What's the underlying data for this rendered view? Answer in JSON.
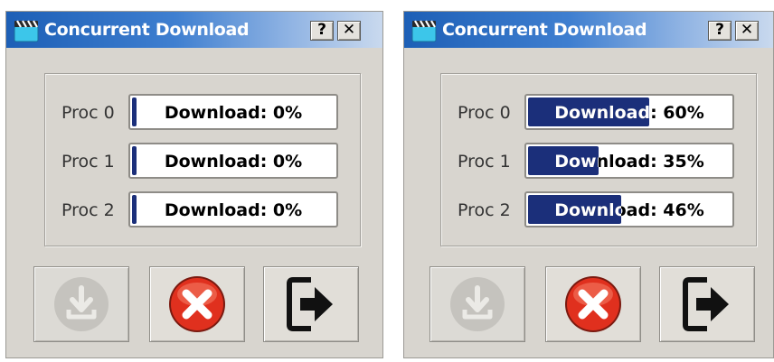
{
  "windows": [
    {
      "title": "Concurrent Download",
      "help_label": "?",
      "close_label": "✕",
      "procs": [
        {
          "label": "Proc 0",
          "text": "Download: 0%",
          "progress": 0
        },
        {
          "label": "Proc 1",
          "text": "Download: 0%",
          "progress": 0
        },
        {
          "label": "Proc 2",
          "text": "Download: 0%",
          "progress": 0
        }
      ],
      "buttons": {
        "download_icon": "download-icon",
        "download_enabled": false,
        "cancel_icon": "cancel-icon",
        "exit_icon": "exit-icon"
      }
    },
    {
      "title": "Concurrent Download",
      "help_label": "?",
      "close_label": "✕",
      "procs": [
        {
          "label": "Proc 0",
          "text": "Download: 60%",
          "progress": 60
        },
        {
          "label": "Proc 1",
          "text": "Download: 35%",
          "progress": 35
        },
        {
          "label": "Proc 2",
          "text": "Download: 46%",
          "progress": 46
        }
      ],
      "buttons": {
        "download_icon": "download-icon",
        "download_enabled": false,
        "cancel_icon": "cancel-icon",
        "exit_icon": "exit-icon"
      }
    }
  ],
  "colors": {
    "progress_fill": "#1b2f7a",
    "titlebar_start": "#1d5fb6",
    "titlebar_end": "#c9d9ee",
    "cancel_red": "#e0301e"
  }
}
